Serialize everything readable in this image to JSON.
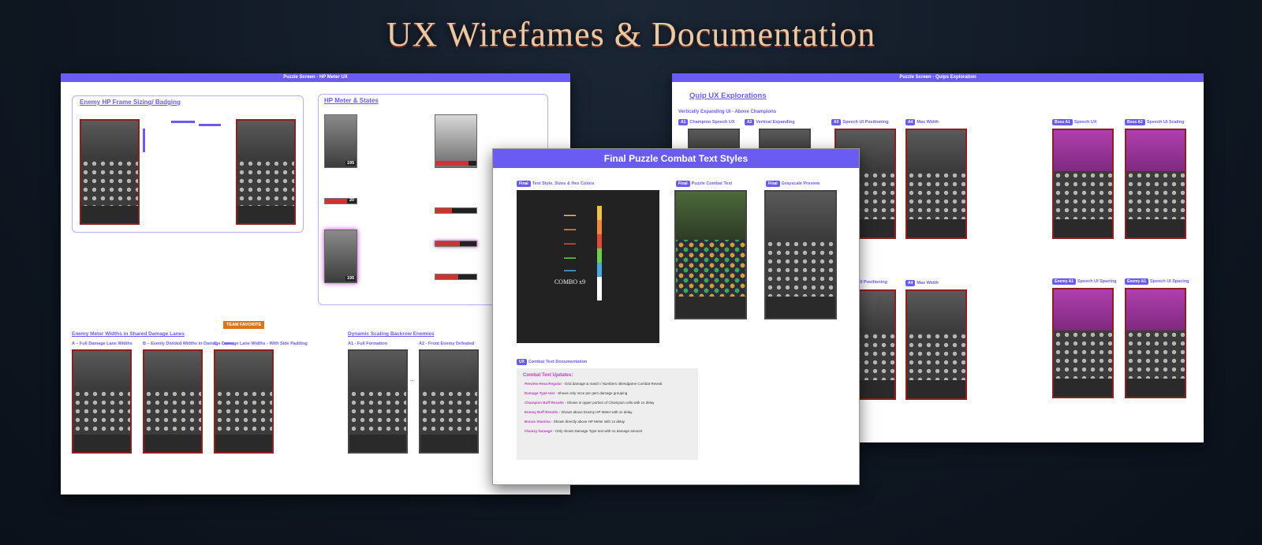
{
  "page": {
    "title": "UX Wirefames & Documentation"
  },
  "colors": {
    "background": "#0f1722",
    "accent": "#6a5cf2",
    "annotation": "#c33ac8",
    "title": "#e8c9a6",
    "team_favorite": "#d9761d"
  },
  "left_board": {
    "header": "Puzzle Screen - HP Meter UX",
    "sec1_title": "Enemy HP Frame Sizing/ Badging",
    "sec2_title": "HP Meter & States",
    "hp_values": [
      "195",
      "20",
      "195"
    ],
    "sec3_title": "Enemy Meter Widths in Shared Damage Lanes",
    "team_favorite": "TEAM FAVORITE",
    "lanes": [
      {
        "letter": "A",
        "label": "Full Damage Lane Widths"
      },
      {
        "letter": "B",
        "label": "Evenly Divided Widths in Damage Lanes"
      },
      {
        "letter": "C",
        "label": "Damage Lane Widths - With Side Padding"
      }
    ],
    "sec4_title": "Dynamic Scaling Backrow Enemies",
    "backrow": [
      "A1 - Full Formation",
      "A2 - Front Enemy Defeated"
    ]
  },
  "right_board": {
    "header": "Puzzle Screen - Quips Exploration",
    "title": "Quip UX Explorations",
    "subtitle": "Vertically Expanding UI - Above Champions",
    "variants": [
      {
        "tag": "A1",
        "label": "Champion Speech UX"
      },
      {
        "tag": "A2",
        "label": "Vertical Expanding"
      },
      {
        "tag": "A3",
        "label": "Speech UI Positioning"
      },
      {
        "tag": "A4",
        "label": "Max Width"
      }
    ],
    "row2_partial": "UI Positioning",
    "row2_variant": {
      "tag": "A4",
      "label": "Max Width"
    },
    "boss": [
      {
        "tag": "Boss A1",
        "label": "Speech UX"
      },
      {
        "tag": "Boss A2",
        "label": "Speech UI Scaling"
      }
    ],
    "enemy": [
      {
        "tag": "Enemy A1",
        "label": "Speech UI Spacing"
      },
      {
        "tag": "Enemy A1",
        "label": "Speech UI Spacing"
      }
    ]
  },
  "center_board": {
    "title": "Final Puzzle Combat Text Styles",
    "panels": [
      {
        "tag": "Final",
        "label": "Text Style, Sizes & Hex Colors"
      },
      {
        "tag": "Final",
        "label": "Puzzle Combat Text"
      },
      {
        "tag": "Final",
        "label": "Grayscale Preview"
      }
    ],
    "combo_text": "COMBO x9",
    "doc_tag": "UX",
    "doc_label": "Combat Text Documentation",
    "doc_heading": "Combat Text Updates:",
    "doc_items": [
      {
        "key": "Preview Hexa Regular",
        "text": "- Grid damage & match / Numbers: Blendgame Combat Reveal"
      },
      {
        "key": "Damage Type text",
        "text": "- Shows only once per gem damage grouping"
      },
      {
        "key": "Champion Buff Results",
        "text": "- Shown in upper portion of Champion cells with 1s delay"
      },
      {
        "key": "Enemy Buff Results",
        "text": "- Shown above Enemy HP Meter with 1s delay"
      },
      {
        "key": "Bonus Stanima",
        "text": "- Shown directly above HP Meter with 1s delay"
      },
      {
        "key": "Clumsy Damage",
        "text": "- Only shows Damage Type text with no damage amount"
      }
    ]
  }
}
